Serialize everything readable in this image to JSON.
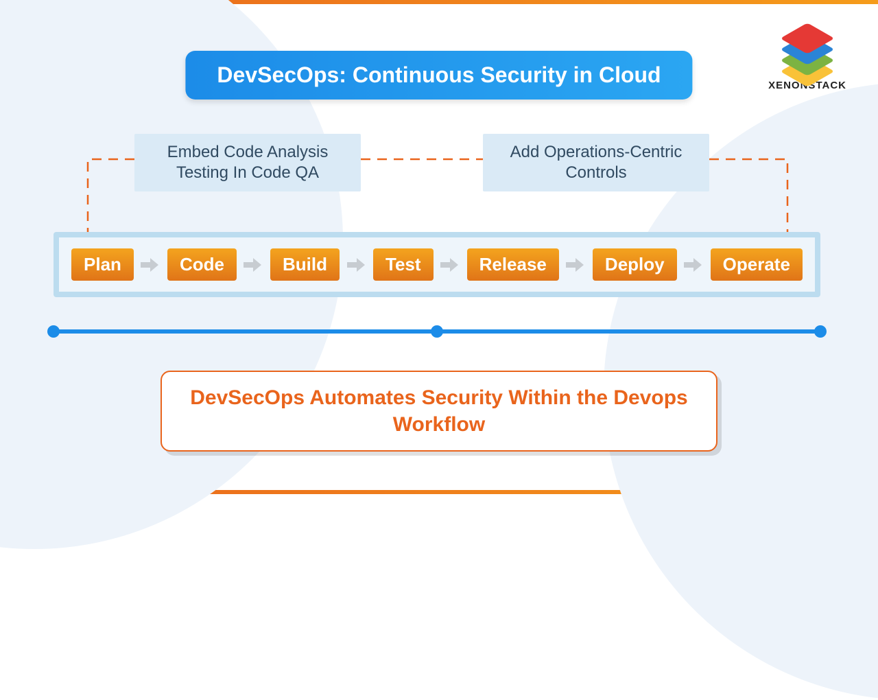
{
  "brand": {
    "name": "XENONSTACK"
  },
  "title": "DevSecOps:  Continuous Security in Cloud",
  "info": {
    "left": "Embed Code Analysis Testing In Code QA",
    "right": "Add Operations-Centric Controls"
  },
  "pipeline": {
    "stages": [
      "Plan",
      "Code",
      "Build",
      "Test",
      "Release",
      "Deploy",
      "Operate"
    ]
  },
  "callout": "DevSecOps Automates Security Within the Devops Workflow",
  "colors": {
    "orange_grad_start": "#E9641C",
    "orange_grad_end": "#F59C1B",
    "blue_grad_start": "#1C8CE8",
    "blue_grad_end": "#2BA6F2",
    "info_bg": "#DAEAF6",
    "pipeline_border": "#bcdcef"
  }
}
